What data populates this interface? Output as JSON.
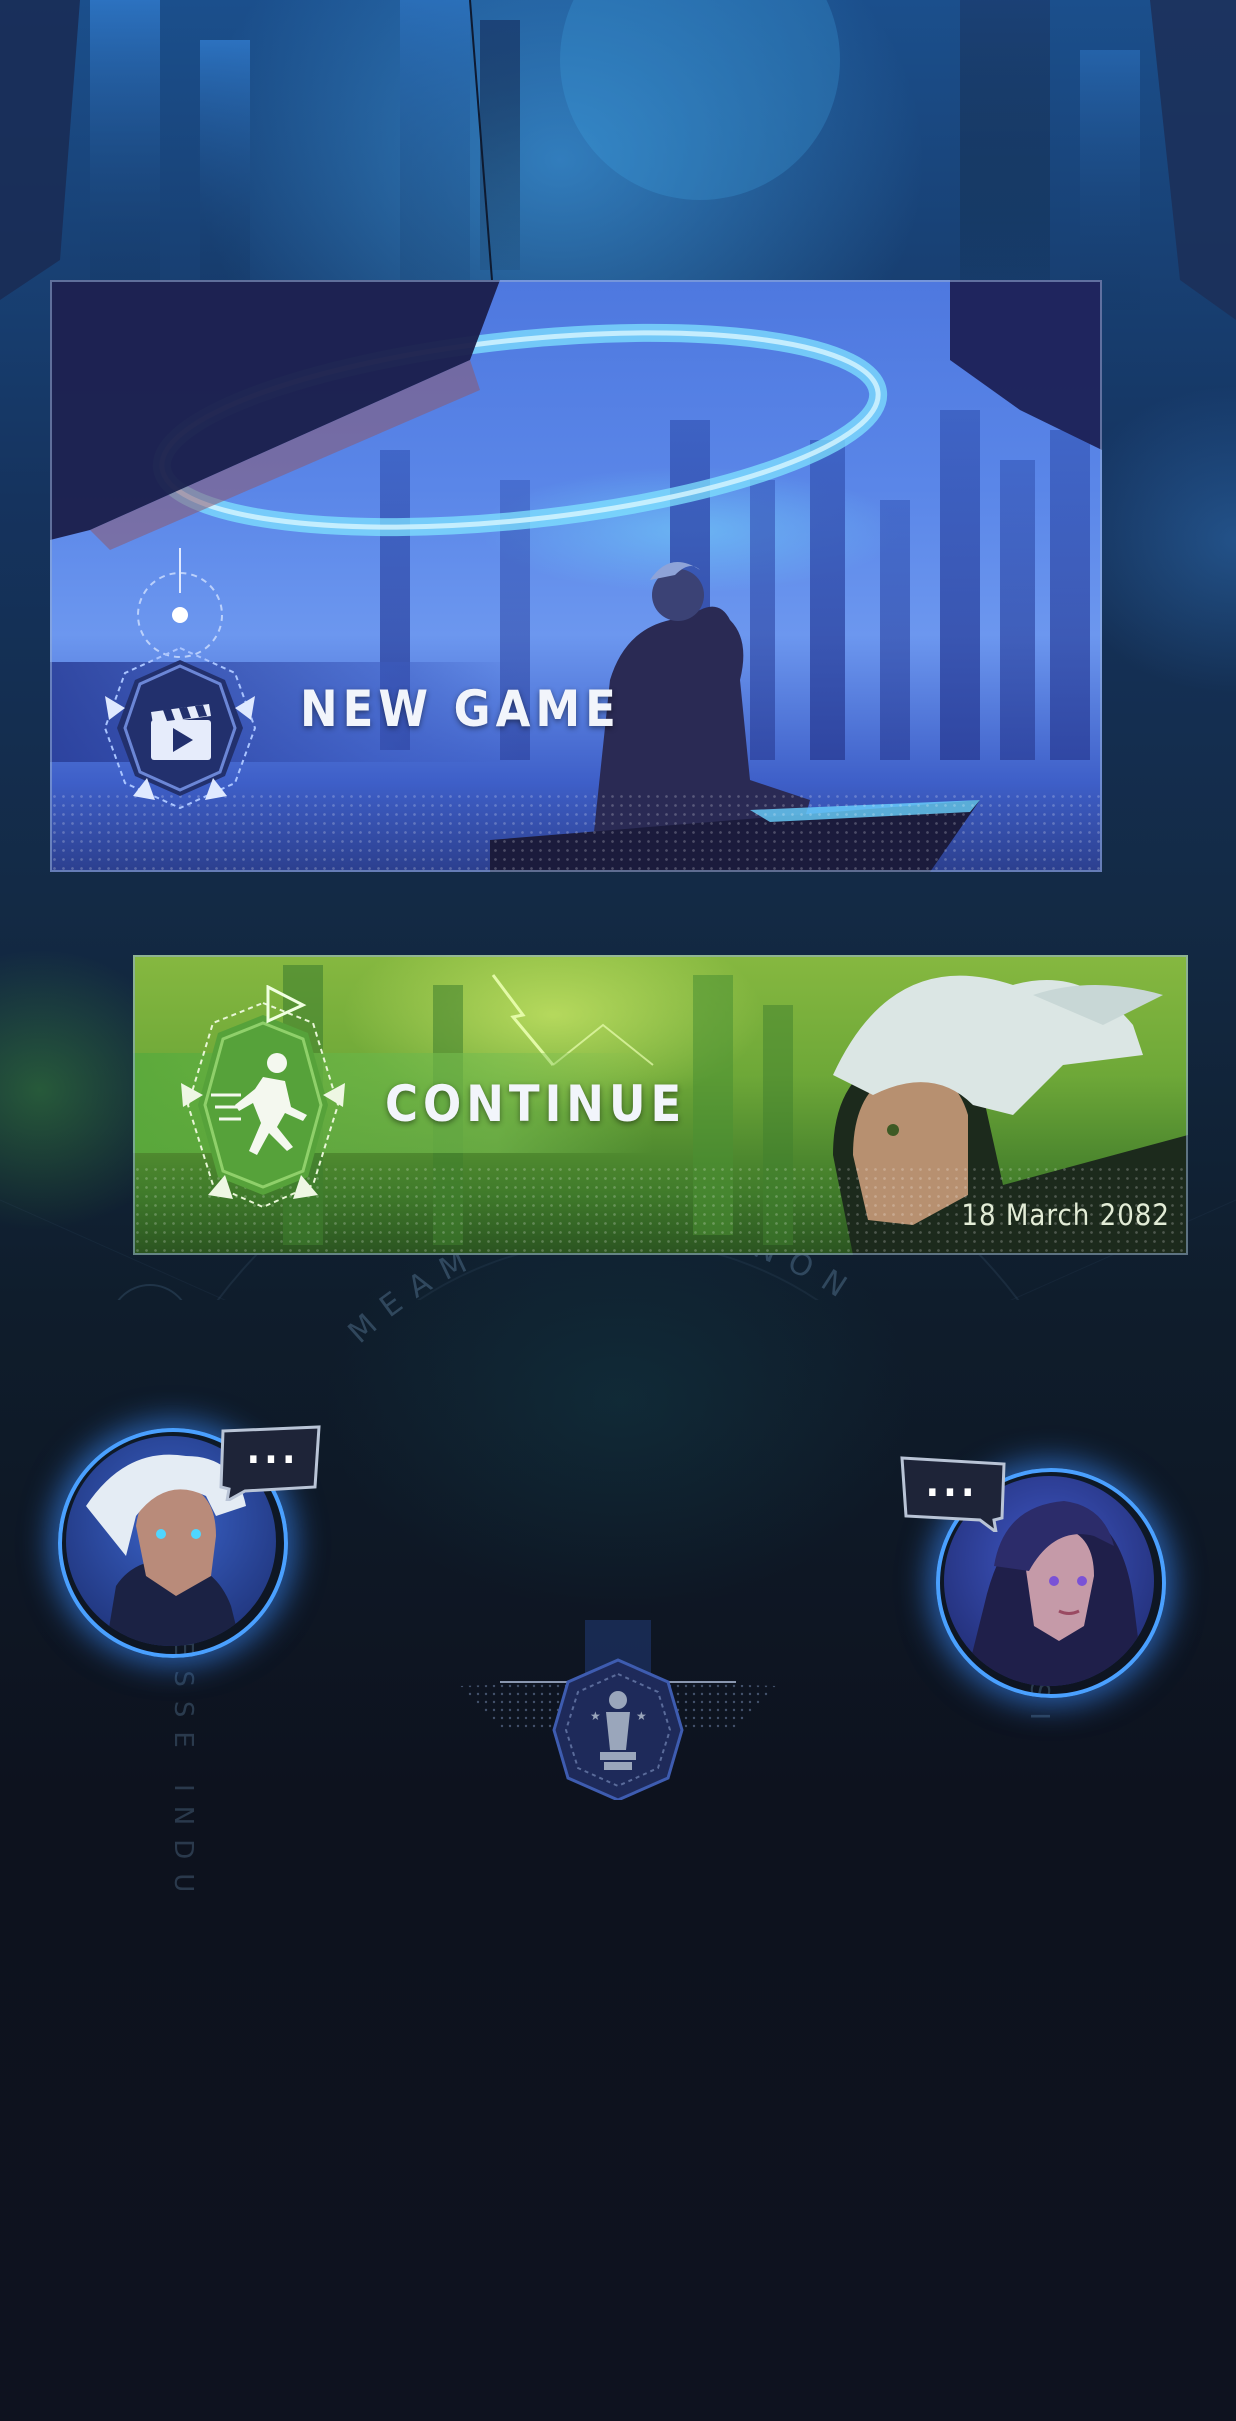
{
  "new_game": {
    "label": "NEW GAME",
    "icon": "clapperboard-play-icon",
    "accent": "#3a5fd1"
  },
  "continue_game": {
    "label": "CONTINUE",
    "icon": "running-figure-icon",
    "accent": "#4fa83a",
    "save_date": "18 March 2082"
  },
  "background_ring_text": {
    "top": "MEAM DISCERE NON",
    "left": "ESSE INDU",
    "right": "IST"
  },
  "characters": {
    "left": {
      "bubble_text": "...",
      "icon": "speech-bubble-icon"
    },
    "right": {
      "bubble_text": "...",
      "icon": "speech-bubble-icon"
    }
  },
  "achievements": {
    "icon": "trophy-icon"
  },
  "colors": {
    "background": "#0e121f",
    "glow_blue": "#3b8cff",
    "card_border": "#96afd7"
  }
}
